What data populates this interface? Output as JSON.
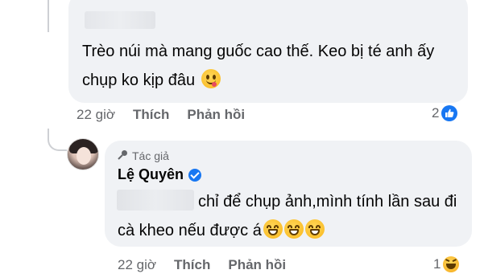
{
  "comment_1": {
    "text": "Trèo núi mà mang guốc cao thế. Keo bị té anh ấy chụp ko kịp đâu",
    "emoji": "face-savoring-food-emoji",
    "time": "22 giờ",
    "like_label": "Thích",
    "reply_label": "Phản hồi",
    "reaction_count": "2",
    "reaction_icon": "like-icon"
  },
  "reply_1": {
    "badge": "Tác giả",
    "author": "Lệ Quyên",
    "verified": true,
    "text": "chỉ để chụp ảnh,mình tính lần sau đi cà kheo nếu được á",
    "emojis": [
      "grinning-face-emoji",
      "grinning-face-emoji",
      "grinning-face-emoji"
    ],
    "time": "22 giờ",
    "like_label": "Thích",
    "reply_label": "Phản hồi",
    "reaction_count": "1",
    "reaction_icon": "haha-icon"
  },
  "colors": {
    "bubble": "#f0f2f5",
    "meta_text": "#65676b",
    "accent": "#1877f2"
  }
}
